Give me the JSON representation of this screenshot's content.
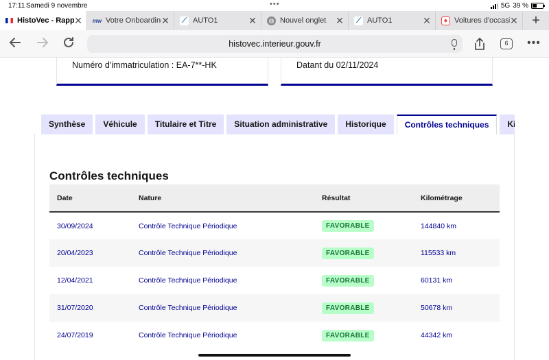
{
  "status": {
    "time": "17:11",
    "date": "Samedi 9 novembre",
    "network": "5G",
    "battery": "39 %"
  },
  "browser_tabs": [
    {
      "title": "HistoVec - Rapport",
      "icon": "french-flag-icon",
      "active": true
    },
    {
      "title": "Votre Onboarding",
      "icon": "mw-logo-icon",
      "active": false
    },
    {
      "title": "AUTO1",
      "icon": "auto1-logo-icon",
      "active": false
    },
    {
      "title": "Nouvel onglet",
      "icon": "globe-icon",
      "active": false
    },
    {
      "title": "AUTO1",
      "icon": "auto1-logo-icon",
      "active": false
    },
    {
      "title": "Voitures d'occasion",
      "icon": "car-site-icon",
      "active": false
    }
  ],
  "toolbar": {
    "url": "histovec.interieur.gouv.fr",
    "tab_count": "6"
  },
  "cards": {
    "registration": "Numéro d'immatriculation : EA-7**-HK",
    "dated": "Datant du 02/11/2024"
  },
  "page_tabs": [
    {
      "label": "Synthèse",
      "active": false
    },
    {
      "label": "Véhicule",
      "active": false
    },
    {
      "label": "Titulaire et Titre",
      "active": false
    },
    {
      "label": "Situation administrative",
      "active": false
    },
    {
      "label": "Historique",
      "active": false
    },
    {
      "label": "Contrôles techniques",
      "active": true
    },
    {
      "label": "Kilométrage",
      "active": false
    }
  ],
  "section": {
    "title": "Contrôles techniques",
    "columns": [
      "Date",
      "Nature",
      "Résultat",
      "Kilométrage"
    ],
    "rows": [
      {
        "date": "30/09/2024",
        "nature": "Contrôle Technique Périodique",
        "result": "FAVORABLE",
        "km": "144840 km"
      },
      {
        "date": "20/04/2023",
        "nature": "Contrôle Technique Périodique",
        "result": "FAVORABLE",
        "km": "115533 km"
      },
      {
        "date": "12/04/2021",
        "nature": "Contrôle Technique Périodique",
        "result": "FAVORABLE",
        "km": "60131 km"
      },
      {
        "date": "31/07/2020",
        "nature": "Contrôle Technique Périodique",
        "result": "FAVORABLE",
        "km": "50678 km"
      },
      {
        "date": "24/07/2019",
        "nature": "Contrôle Technique Périodique",
        "result": "FAVORABLE",
        "km": "44342 km"
      }
    ]
  },
  "colors": {
    "accent": "#000091",
    "tab_bg": "#e3e3fd",
    "badge_bg": "#b8fec9",
    "badge_text": "#18753c"
  }
}
